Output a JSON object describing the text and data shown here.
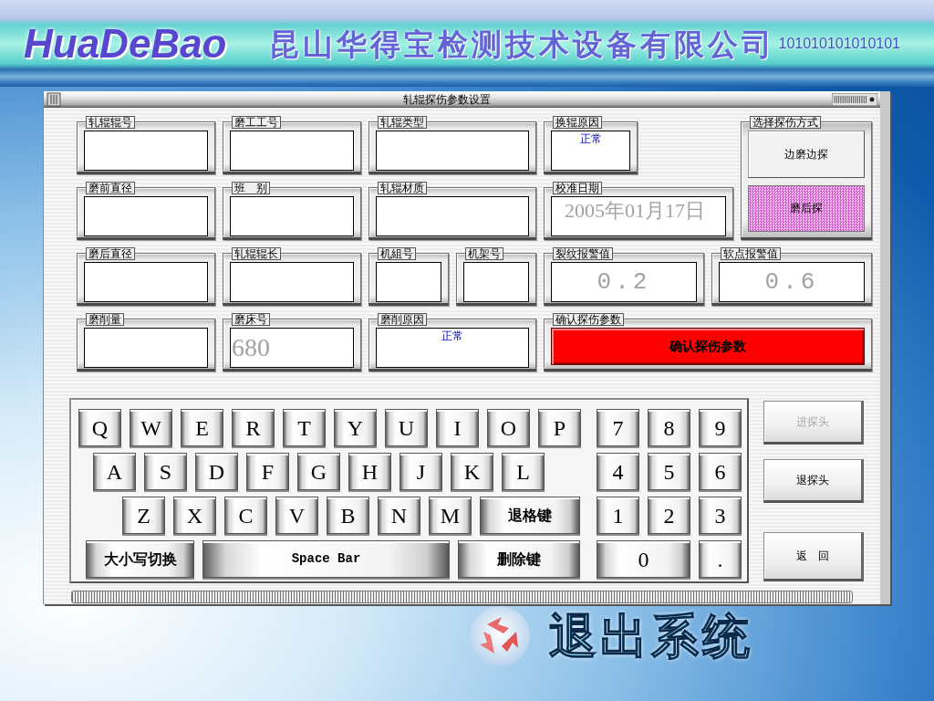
{
  "banner": {
    "logo": "HuaDeBao",
    "company": "昆山华得宝检测技术设备有限公司",
    "binary": "101010101010101"
  },
  "dialog": {
    "title": "轧辊探伤参数设置",
    "rows": [
      [
        {
          "label": "轧辊辊号",
          "kind": "text"
        },
        {
          "label": "磨工工号",
          "kind": "text"
        },
        {
          "label": "轧辊类型",
          "kind": "text"
        },
        {
          "label": "换辊原因",
          "kind": "text",
          "value": "正常"
        }
      ],
      [
        {
          "label": "磨前直径",
          "kind": "text"
        },
        {
          "label": "班　别",
          "kind": "text"
        },
        {
          "label": "轧辊材质",
          "kind": "text"
        },
        {
          "label": "校准日期",
          "kind": "date",
          "value": "2005年01月17日",
          "disabled": true
        }
      ],
      [
        {
          "label": "磨后直径",
          "kind": "text"
        },
        {
          "label": "轧辊辊长",
          "kind": "text"
        },
        {
          "label": "机組号",
          "kind": "text"
        },
        {
          "label": "机架号",
          "kind": "text"
        },
        {
          "label": "裂纹报警值",
          "kind": "reading",
          "value": "0.2",
          "disabled": true
        },
        {
          "label": "软点报警值",
          "kind": "reading",
          "value": "0.6",
          "disabled": true
        }
      ],
      [
        {
          "label": "磨削量",
          "kind": "text"
        },
        {
          "label": "磨床号",
          "kind": "number",
          "value": "680",
          "disabled": true
        },
        {
          "label": "磨削原因",
          "kind": "text",
          "value": "正常"
        },
        {
          "label": "确认探伤参数",
          "kind": "button",
          "value": "确认探伤参数"
        }
      ]
    ],
    "mode": {
      "label": "选择探伤方式",
      "options": [
        {
          "label": "边磨边探",
          "selected": false
        },
        {
          "label": "磨后探",
          "selected": true
        }
      ]
    },
    "keyboard": {
      "letter_rows": [
        {
          "keys": [
            "Q",
            "W",
            "E",
            "R",
            "T",
            "Y",
            "U",
            "I",
            "O",
            "P"
          ]
        },
        {
          "keys": [
            "A",
            "S",
            "D",
            "F",
            "G",
            "H",
            "J",
            "K",
            "L"
          ]
        },
        {
          "keys": [
            "Z",
            "X",
            "C",
            "V",
            "B",
            "N",
            "M",
            "退格键"
          ]
        },
        {
          "keys": [
            "大小写切换",
            "Space Bar",
            "删除键"
          ]
        }
      ],
      "numpad_rows": [
        {
          "keys": [
            "7",
            "8",
            "9"
          ]
        },
        {
          "keys": [
            "4",
            "5",
            "6"
          ]
        },
        {
          "keys": [
            "1",
            "2",
            "3"
          ]
        },
        {
          "keys": [
            "0",
            "."
          ]
        }
      ]
    },
    "side_buttons": [
      {
        "label": "进探头",
        "disabled": true
      },
      {
        "label": "退探头",
        "disabled": false
      },
      {
        "label": "返　回",
        "disabled": false
      }
    ]
  },
  "exit_button": "退出系统"
}
